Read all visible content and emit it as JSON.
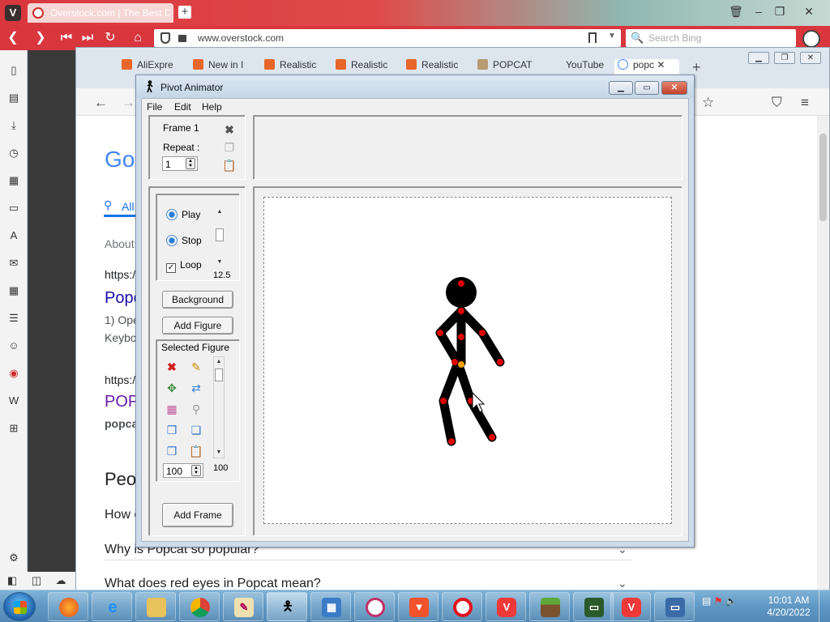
{
  "vivaldi": {
    "tab_title": "Overstock.com | The Best D",
    "url": "www.overstock.com",
    "search_placeholder": "Search Bing"
  },
  "firefox": {
    "tabs": [
      {
        "label": "AliExpre"
      },
      {
        "label": "New in I"
      },
      {
        "label": "Realistic"
      },
      {
        "label": "Realistic"
      },
      {
        "label": "Realistic"
      },
      {
        "label": "POPCAT"
      },
      {
        "label": "YouTube"
      },
      {
        "label": "popc"
      }
    ],
    "page_fragments": {
      "google_logo": "Go",
      "tab_all": "All",
      "about": "About",
      "https1": "https:/",
      "popcat_link": "Popc",
      "snippet1": "1) Ope",
      "snippet2": "Keybo",
      "https2": "https:/",
      "popcat_link2": "POP",
      "popcat_small": "popca",
      "people_heading": "Peo",
      "q1": "How c",
      "q2": "Why is Popcat so popular?",
      "q3": "What does red eyes in Popcat mean?"
    }
  },
  "pivot": {
    "title": "Pivot Animator",
    "menu": [
      "File",
      "Edit",
      "Help"
    ],
    "frame_label": "Frame 1",
    "repeat_label": "Repeat :",
    "repeat_value": "1",
    "play_label": "Play",
    "stop_label": "Stop",
    "loop_label": "Loop",
    "loop_checked": true,
    "speed_value": "12.5",
    "background_button": "Background",
    "add_figure_button": "Add Figure",
    "selected_figure_label": "Selected Figure",
    "figure_scale_value": "100",
    "figure_scale_readout": "100",
    "add_frame_button": "Add Frame"
  },
  "taskbar": {
    "time": "10:01 AM",
    "date": "4/20/2022",
    "apps": [
      "firefox",
      "internet-explorer",
      "file-explorer",
      "chrome",
      "paint",
      "pivot",
      "control-panel",
      "opera",
      "brave",
      "opera-red",
      "vivaldi",
      "minecraft",
      "terminal",
      "vivaldi-2",
      "remote-desktop"
    ]
  },
  "colors": {
    "vivaldi_red": "#d9363e",
    "joint_red": "#e00000",
    "joint_orange": "#f5a000",
    "figure_black": "#000000"
  }
}
